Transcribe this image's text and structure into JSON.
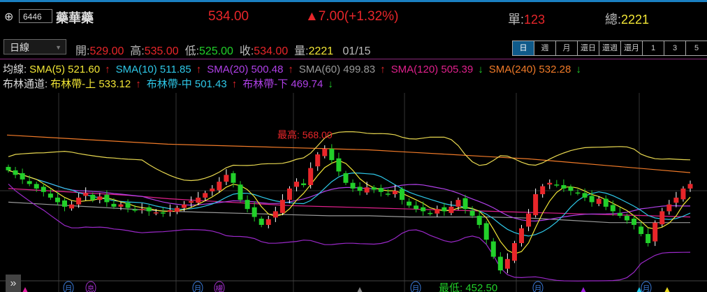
{
  "header": {
    "add_icon": "plus-circle-icon",
    "code": "6446",
    "name": "藥華藥",
    "price": "534.00",
    "change": "▲7.00(+1.32%)",
    "single_label": "單:",
    "single_value": "123",
    "total_label": "總:",
    "total_value": "2221"
  },
  "toolbar": {
    "period": "日線",
    "open_label": "開:",
    "open": "529.00",
    "high_label": "高:",
    "high": "535.00",
    "low_label": "低:",
    "low": "525.00",
    "close_label": "收:",
    "close": "534.00",
    "vol_label": "量:",
    "vol": "2221",
    "date": "01/15",
    "tabs": [
      "日",
      "週",
      "月",
      "還日",
      "還週",
      "還月",
      "1",
      "3",
      "5"
    ],
    "active_tab": 0
  },
  "legend": {
    "ma_title": "均線:",
    "bb_title": "布林通道:",
    "ma": [
      {
        "label": "SMA(5) 521.60",
        "arrow": "↑",
        "color": "#f2e636"
      },
      {
        "label": "SMA(10) 511.85",
        "arrow": "↑",
        "color": "#2ec8e8"
      },
      {
        "label": "SMA(20) 500.48",
        "arrow": "↑",
        "color": "#b040e8"
      },
      {
        "label": "SMA(60) 499.83",
        "arrow": "↑",
        "color": "#999999"
      },
      {
        "label": "SMA(120) 505.39",
        "arrow": "↓",
        "color": "#e0208c"
      },
      {
        "label": "SMA(240) 532.28",
        "arrow": "↓",
        "color": "#f07a28"
      }
    ],
    "bb": [
      {
        "label": "布林帶-上 533.12",
        "arrow": "↑",
        "color": "#f2e636"
      },
      {
        "label": "布林帶-中 501.43",
        "arrow": "↑",
        "color": "#2ec8e8"
      },
      {
        "label": "布林帶-下 469.74",
        "arrow": "↓",
        "color": "#b040e8"
      }
    ]
  },
  "chart_data": {
    "type": "candlestick",
    "high_label": "最高: 568.00",
    "low_label": "最低: 452.50",
    "ylim": [
      440,
      590
    ],
    "closes": [
      546,
      542,
      538,
      534,
      530,
      527,
      522,
      518,
      514,
      516,
      522,
      526,
      520,
      523,
      518,
      514,
      516,
      513,
      511,
      512,
      510,
      509,
      508,
      511,
      513,
      516,
      519,
      522,
      526,
      530,
      536,
      542,
      535,
      520,
      512,
      505,
      498,
      503,
      510,
      520,
      530,
      536,
      533,
      548,
      560,
      565,
      555,
      545,
      535,
      530,
      528,
      531,
      529,
      527,
      525,
      528,
      520,
      515,
      512,
      510,
      508,
      512,
      510,
      514,
      520,
      512,
      506,
      498,
      485,
      470,
      458,
      468,
      482,
      495,
      508,
      525,
      532,
      535,
      533,
      530,
      528,
      526,
      522,
      518,
      521,
      514,
      510,
      506,
      502,
      498,
      490,
      482,
      500,
      510,
      516,
      522,
      530,
      534
    ],
    "sma60": [
      518,
      516,
      514,
      512,
      510,
      509,
      508,
      507,
      506,
      506,
      505,
      505,
      505,
      504,
      502,
      500,
      500,
      500
    ],
    "sma120": [
      530,
      528,
      526,
      524,
      521,
      519,
      517,
      515,
      514,
      513,
      512,
      511,
      510,
      509,
      508,
      507,
      506,
      505
    ],
    "sma240": [
      577,
      575,
      573,
      571,
      569,
      568,
      567,
      566,
      565,
      564,
      562,
      560,
      558,
      556,
      553,
      550,
      547,
      544
    ],
    "markers": [
      "月",
      "息",
      "月",
      "權",
      "月",
      "月",
      "月"
    ]
  },
  "expand_icon": "double-chevron-right-icon"
}
